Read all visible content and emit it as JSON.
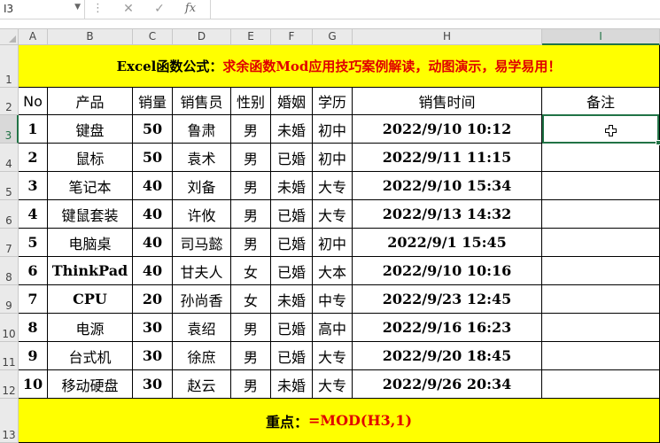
{
  "name_box": "I3",
  "formula_bar": {
    "cancel_glyph": "✕",
    "enter_glyph": "✓",
    "fx_label": "fx",
    "more_glyph": "⋮",
    "dropdown_glyph": "▼",
    "formula": ""
  },
  "columns": [
    "A",
    "B",
    "C",
    "D",
    "E",
    "F",
    "G",
    "H",
    "I"
  ],
  "rows": [
    "1",
    "2",
    "3",
    "4",
    "5",
    "6",
    "7",
    "8",
    "9",
    "10",
    "11",
    "12",
    "13"
  ],
  "title": {
    "prefix": "Excel函数公式：",
    "main": "求余函数Mod应用技巧案例解读，动图演示，易学易用！"
  },
  "headers": [
    "No",
    "产品",
    "销量",
    "销售员",
    "性别",
    "婚姻",
    "学历",
    "销售时间",
    "备注"
  ],
  "table": [
    [
      "1",
      "键盘",
      "50",
      "鲁肃",
      "男",
      "未婚",
      "初中",
      "2022/9/10 10:12",
      ""
    ],
    [
      "2",
      "鼠标",
      "50",
      "袁术",
      "男",
      "已婚",
      "初中",
      "2022/9/11 11:15",
      ""
    ],
    [
      "3",
      "笔记本",
      "40",
      "刘备",
      "男",
      "未婚",
      "大专",
      "2022/9/10 15:34",
      ""
    ],
    [
      "4",
      "键鼠套装",
      "40",
      "许攸",
      "男",
      "已婚",
      "大专",
      "2022/9/13 14:32",
      ""
    ],
    [
      "5",
      "电脑桌",
      "40",
      "司马懿",
      "男",
      "已婚",
      "初中",
      "2022/9/1 15:45",
      ""
    ],
    [
      "6",
      "ThinkPad",
      "40",
      "甘夫人",
      "女",
      "已婚",
      "大本",
      "2022/9/10 10:16",
      ""
    ],
    [
      "7",
      "CPU",
      "20",
      "孙尚香",
      "女",
      "未婚",
      "中专",
      "2022/9/23 12:45",
      ""
    ],
    [
      "8",
      "电源",
      "30",
      "袁绍",
      "男",
      "已婚",
      "高中",
      "2022/9/16 16:23",
      ""
    ],
    [
      "9",
      "台式机",
      "30",
      "徐庶",
      "男",
      "已婚",
      "大专",
      "2022/9/20 18:45",
      ""
    ],
    [
      "10",
      "移动硬盘",
      "30",
      "赵云",
      "男",
      "未婚",
      "大专",
      "2022/9/26 20:34",
      ""
    ]
  ],
  "footer": {
    "label": "重点：",
    "formula": "=MOD(H3,1)"
  },
  "colors": {
    "banner": "#ffff00",
    "title_red": "#e00000",
    "selection": "#217346"
  }
}
